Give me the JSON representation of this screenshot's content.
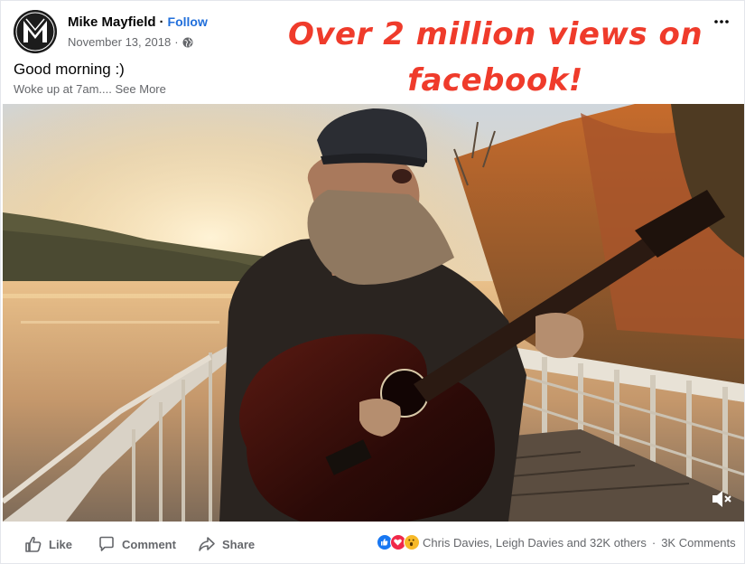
{
  "post": {
    "author": "Mike Mayfield",
    "separator": "·",
    "follow_label": "Follow",
    "date": "November 13, 2018",
    "date_separator": "·",
    "title": "Good morning :)",
    "body_preview": "Woke up at 7am....",
    "see_more_label": "See More",
    "overlay_text": "Over 2 million views on facebook!",
    "avatar_logo_text": "M"
  },
  "actions": {
    "like_label": "Like",
    "comment_label": "Comment",
    "share_label": "Share"
  },
  "reactions": {
    "icons": [
      "like-icon",
      "love-icon",
      "wow-icon"
    ],
    "reactors_text": "Chris Davies, Leigh Davies and 32K others",
    "separator": "·",
    "comments_text": "3K Comments"
  },
  "colors": {
    "overlay_red": "#ef3b2b",
    "follow_blue": "#216fdb",
    "like_blue": "#1877f2",
    "love_red": "#f02849",
    "wow_yellow": "#f7b928",
    "secondary_text": "#65676b"
  }
}
